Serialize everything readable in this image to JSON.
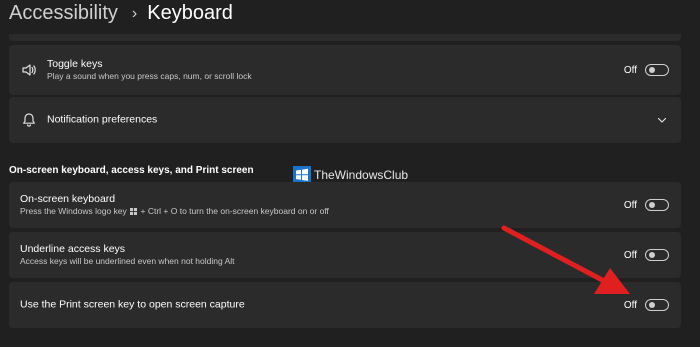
{
  "breadcrumb": {
    "parent": "Accessibility",
    "separator": "›",
    "current": "Keyboard"
  },
  "toggle_keys": {
    "title": "Toggle keys",
    "description": "Play a sound when you press caps, num, or scroll lock",
    "state": "Off",
    "icon": "speaker-icon"
  },
  "notification_preferences": {
    "title": "Notification preferences",
    "icon": "bell-icon"
  },
  "section_heading": "On-screen keyboard, access keys, and Print screen",
  "watermark": {
    "text": "TheWindowsClub"
  },
  "onscreen_keyboard": {
    "title": "On-screen keyboard",
    "desc_before": "Press the Windows logo key",
    "desc_after": "+ Ctrl + O to turn the on-screen keyboard on or off",
    "state": "Off"
  },
  "underline_access_keys": {
    "title": "Underline access keys",
    "description": "Access keys will be underlined even when not holding Alt",
    "state": "Off"
  },
  "print_screen": {
    "title": "Use the Print screen key to open screen capture",
    "state": "Off"
  },
  "colors": {
    "background": "#202020",
    "card": "#2b2b2b",
    "annotation_arrow": "#e02020"
  }
}
